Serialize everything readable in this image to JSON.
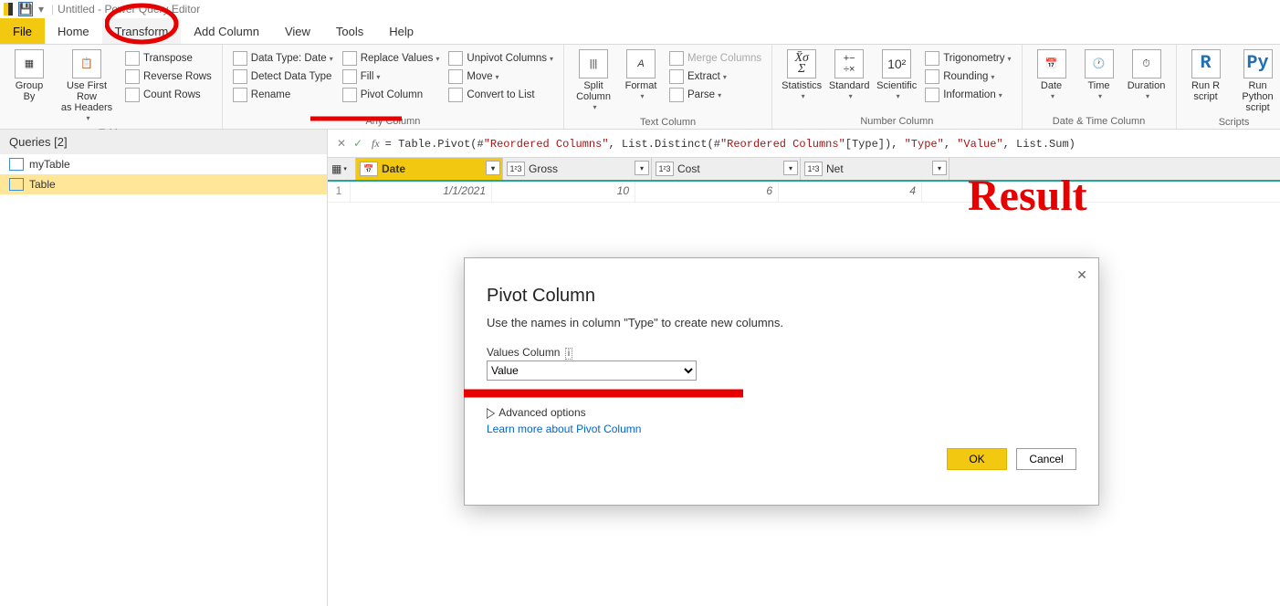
{
  "window": {
    "title": "Untitled - Power Query Editor"
  },
  "menu": {
    "file": "File",
    "home": "Home",
    "transform": "Transform",
    "addcolumn": "Add Column",
    "view": "View",
    "tools": "Tools",
    "help": "Help"
  },
  "ribbon": {
    "groups": {
      "table": {
        "label": "Table",
        "group_by": "Group\nBy",
        "use_first_row": "Use First Row\nas Headers",
        "transpose": "Transpose",
        "reverse_rows": "Reverse Rows",
        "count_rows": "Count Rows"
      },
      "anycol": {
        "label": "Any Column",
        "data_type": "Data Type: Date",
        "detect_type": "Detect Data Type",
        "rename": "Rename",
        "replace_values": "Replace Values",
        "fill": "Fill",
        "pivot_column": "Pivot Column",
        "unpivot_columns": "Unpivot Columns",
        "move": "Move",
        "convert_to_list": "Convert to List"
      },
      "textcol": {
        "label": "Text Column",
        "split_column": "Split\nColumn",
        "format": "Format",
        "merge_columns": "Merge Columns",
        "extract": "Extract",
        "parse": "Parse"
      },
      "numcol": {
        "label": "Number Column",
        "statistics": "Statistics",
        "standard": "Standard",
        "scientific": "Scientific",
        "trigonometry": "Trigonometry",
        "rounding": "Rounding",
        "information": "Information"
      },
      "datetime": {
        "label": "Date & Time Column",
        "date": "Date",
        "time": "Time",
        "duration": "Duration"
      },
      "scripts": {
        "label": "Scripts",
        "run_r": "Run R\nscript",
        "run_py": "Run Python\nscript"
      }
    }
  },
  "queries": {
    "header": "Queries [2]",
    "items": [
      {
        "name": "myTable"
      },
      {
        "name": "Table"
      }
    ]
  },
  "formula": {
    "prefix": "= Table.Pivot(#",
    "arg1": "\"Reordered Columns\"",
    "mid1": ", List.Distinct(#",
    "arg2": "\"Reordered Columns\"",
    "mid2": "[Type]), ",
    "arg3": "\"Type\"",
    "mid3": ", ",
    "arg4": "\"Value\"",
    "suffix": ", List.Sum)"
  },
  "table": {
    "columns": [
      {
        "name": "Date",
        "type": "date"
      },
      {
        "name": "Gross",
        "type": "number"
      },
      {
        "name": "Cost",
        "type": "number"
      },
      {
        "name": "Net",
        "type": "number"
      }
    ],
    "rows": [
      {
        "idx": "1",
        "Date": "1/1/2021",
        "Gross": "10",
        "Cost": "6",
        "Net": "4"
      }
    ]
  },
  "dialog": {
    "title": "Pivot Column",
    "description": "Use the names in column \"Type\" to create new columns.",
    "values_label": "Values Column",
    "values_selected": "Value",
    "advanced": "Advanced options",
    "learn_more": "Learn more about Pivot Column",
    "ok": "OK",
    "cancel": "Cancel"
  },
  "annotations": {
    "result": "Result"
  }
}
